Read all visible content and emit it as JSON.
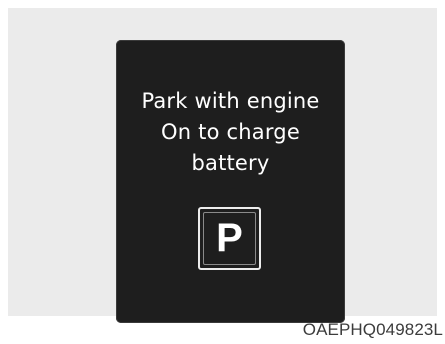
{
  "display": {
    "message_lines": [
      "Park with engine",
      "On to charge",
      "battery"
    ],
    "gear_indicator": "P"
  },
  "figure_code": "OAEPHQ049823L"
}
